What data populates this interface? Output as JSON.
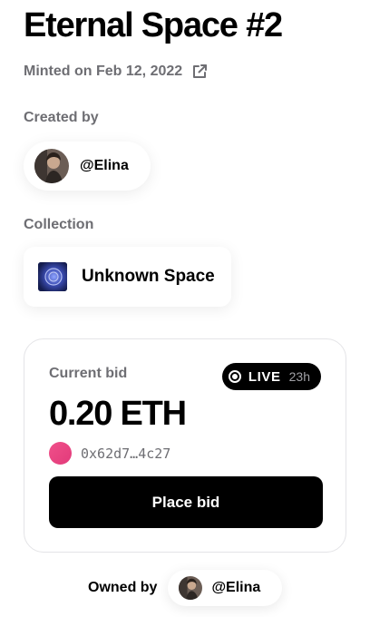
{
  "title": "Eternal Space #2",
  "minted": {
    "text": "Minted on Feb 12, 2022",
    "icon": "external-link-icon"
  },
  "creator": {
    "label": "Created by",
    "handle": "@Elina",
    "avatar_icon": "avatar-photo"
  },
  "collection": {
    "label": "Collection",
    "name": "Unknown Space",
    "thumb_icon": "collection-thumbnail"
  },
  "bid": {
    "label": "Current bid",
    "live_label": "LIVE",
    "time_left": "23h",
    "amount": "0.20 ETH",
    "bidder_address": "0x62d7…4c27",
    "bidder_color": "#e8437f",
    "button_label": "Place bid"
  },
  "owner": {
    "label": "Owned by",
    "handle": "@Elina"
  },
  "colors": {
    "text_primary": "#000000",
    "text_secondary": "#6e6e73",
    "button_bg": "#000000",
    "card_border": "#e4e4e7"
  }
}
